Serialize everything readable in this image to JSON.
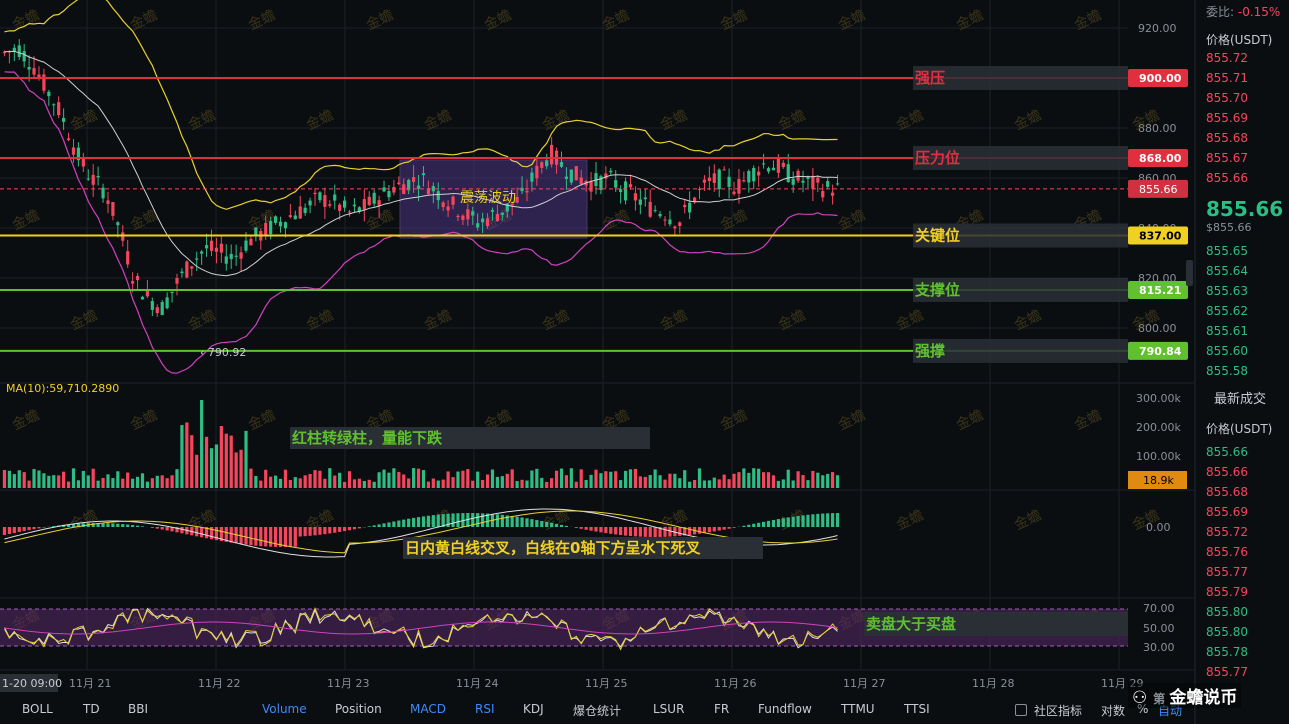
{
  "chart_data": {
    "type": "candlestick",
    "price_axis": {
      "min": 780,
      "max": 930,
      "ticks": [
        800,
        820,
        840,
        860,
        880,
        900,
        920
      ],
      "tick_labels": [
        "800.00",
        "820.00",
        "840.00",
        "860.00",
        "880.00",
        "900.00",
        "920.00"
      ]
    },
    "x_ticks": [
      "11月 21",
      "11月 22",
      "11月 23",
      "11月 24",
      "11月 25",
      "11月 26",
      "11月 27",
      "11月 28",
      "11月 29"
    ],
    "crosshair_label": "1-20 09:00",
    "approx_candles_hourly": [
      910,
      912,
      905,
      895,
      885,
      870,
      860,
      855,
      840,
      820,
      812,
      808,
      818,
      826,
      832,
      830,
      828,
      835,
      838,
      842,
      845,
      848,
      852,
      850,
      846,
      848,
      852,
      856,
      858,
      860,
      855,
      850,
      846,
      842,
      845,
      848,
      852,
      862,
      870,
      864,
      860,
      858,
      860,
      856,
      852,
      848,
      846,
      842,
      852,
      858,
      860,
      856,
      862,
      866,
      864,
      860,
      858,
      856,
      855.66
    ],
    "levels": [
      {
        "label": "强压",
        "value": 900.0,
        "price_label": "900.00",
        "color": "#e03040"
      },
      {
        "label": "压力位",
        "value": 868.0,
        "price_label": "868.00",
        "color": "#e03040"
      },
      {
        "label": "关键位",
        "value": 837.0,
        "price_label": "837.00",
        "color": "#f0d020"
      },
      {
        "label": "支撑位",
        "value": 815.21,
        "price_label": "815.21",
        "color": "#60c030"
      },
      {
        "label": "强撑",
        "value": 790.84,
        "price_label": "790.84",
        "color": "#60c030"
      }
    ],
    "current_price": 855.66,
    "current_price_label": "855.66",
    "low_marker": "790.92",
    "box_annotation": "震荡波动",
    "volume": {
      "ma_label": "MA(10):59,710.2890",
      "ticks": [
        "300.00k",
        "200.00k",
        "100.00k"
      ],
      "current_label": "18.9k",
      "annotation": "红柱转绿柱，量能下跌"
    },
    "macd": {
      "zero_label": "0.00",
      "annotation": "日内黄白线交叉，白线在0轴下方呈水下死叉"
    },
    "rsi": {
      "ticks": [
        "70.00",
        "50.00",
        "30.00"
      ],
      "annotation": "卖盘大于买盘"
    }
  },
  "order_book": {
    "ratio_label": "委比:",
    "ratio_value": "-0.15%",
    "price_header": "价格(USDT)",
    "asks": [
      "855.72",
      "855.71",
      "855.70",
      "855.69",
      "855.68",
      "855.67",
      "855.66"
    ],
    "mid_price": "855.66",
    "mid_sub": "$855.66",
    "bids": [
      "855.65",
      "855.64",
      "855.63",
      "855.62",
      "855.61",
      "855.60",
      "855.58"
    ],
    "trades_title": "最新成交",
    "trades_header": "价格(USDT)",
    "trades": [
      {
        "p": "855.66",
        "c": "#2ebd85"
      },
      {
        "p": "855.66",
        "c": "#f6465d"
      },
      {
        "p": "855.68",
        "c": "#f6465d"
      },
      {
        "p": "855.69",
        "c": "#f6465d"
      },
      {
        "p": "855.72",
        "c": "#f6465d"
      },
      {
        "p": "855.76",
        "c": "#f6465d"
      },
      {
        "p": "855.77",
        "c": "#f6465d"
      },
      {
        "p": "855.79",
        "c": "#f6465d"
      },
      {
        "p": "855.80",
        "c": "#2ebd85"
      },
      {
        "p": "855.80",
        "c": "#2ebd85"
      },
      {
        "p": "855.78",
        "c": "#2ebd85"
      },
      {
        "p": "855.77",
        "c": "#f6465d"
      }
    ]
  },
  "toolbar": {
    "left": [
      "BOLL",
      "TD",
      "BBI"
    ],
    "right": [
      "Volume",
      "Position",
      "MACD",
      "RSI",
      "KDJ",
      "爆仓统计",
      "LSUR",
      "FR",
      "Fundflow",
      "TTMU",
      "TTSI"
    ],
    "active": [
      "Volume",
      "MACD",
      "RSI"
    ],
    "community": "社区指标",
    "pair_label": "对数",
    "percent_label": "%",
    "auto_label": "自动"
  },
  "watermark": "金蟾",
  "brand": "金蟾说币",
  "brand_partial": "第",
  "colors": {
    "up": "#f6465d",
    "down": "#2ebd85",
    "bg": "#0b0e11",
    "grid": "#1c2128"
  }
}
